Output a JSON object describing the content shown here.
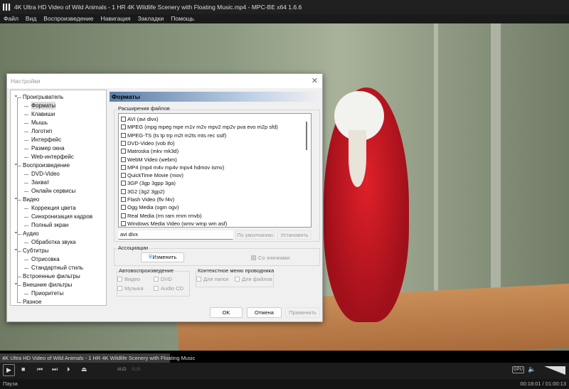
{
  "window": {
    "title": "4K Ultra HD Video of Wild Animals - 1 HR 4K Wildlife Scenery with Floating Music.mp4 - MPC-BE x64 1.6.6"
  },
  "menu": [
    "Файл",
    "Вид",
    "Воспроизведение",
    "Навигация",
    "Закладки",
    "Помощь"
  ],
  "player": {
    "filename": "4K Ultra HD Video of Wild Animals - 1 HR 4K Wildlife Scenery with Floating Music",
    "aud": "AUD",
    "sub": "SUB",
    "gpu": "GPU",
    "status": "Пауза",
    "time": "00:18:01 / 01:00:13",
    "progress": 0.299
  },
  "dialog": {
    "title": "Настройки",
    "tree": [
      {
        "label": "Проигрыватель",
        "level": 0
      },
      {
        "label": "Форматы",
        "level": 1,
        "selected": true
      },
      {
        "label": "Клавиши",
        "level": 1
      },
      {
        "label": "Мышь",
        "level": 1
      },
      {
        "label": "Логотип",
        "level": 1
      },
      {
        "label": "Интерфейс",
        "level": 1
      },
      {
        "label": "Размер окна",
        "level": 1
      },
      {
        "label": "Web-интерфейс",
        "level": 1
      },
      {
        "label": "Воспроизведение",
        "level": 0
      },
      {
        "label": "DVD-Video",
        "level": 1
      },
      {
        "label": "Захват",
        "level": 1
      },
      {
        "label": "Онлайн сервисы",
        "level": 1
      },
      {
        "label": "Видео",
        "level": 0
      },
      {
        "label": "Коррекция цвета",
        "level": 1
      },
      {
        "label": "Синхронизация кадров",
        "level": 1
      },
      {
        "label": "Полный экран",
        "level": 1
      },
      {
        "label": "Аудио",
        "level": 0
      },
      {
        "label": "Обработка звука",
        "level": 1
      },
      {
        "label": "Субтитры",
        "level": 0
      },
      {
        "label": "Отрисовка",
        "level": 1
      },
      {
        "label": "Стандартный стиль",
        "level": 1
      },
      {
        "label": "Встроенные фильтры",
        "level": 0
      },
      {
        "label": "Внешние фильтры",
        "level": 0
      },
      {
        "label": "Приоритеты",
        "level": 1
      },
      {
        "label": "Разное",
        "level": 0
      }
    ],
    "section_title": "Форматы",
    "extensions_label": "Расширения файлов",
    "formats": [
      "AVI (avi divx)",
      "MPEG (mpg mpeg mpe m1v m2v mpv2 mp2v pva evo m2p sfd)",
      "MPEG-TS (ts tp trp m2t m2ts mts rec ssif)",
      "DVD-Video (vob ifo)",
      "Matroska (mkv mk3d)",
      "WebM Video (webm)",
      "MP4 (mp4 m4v mp4v mpv4 hdmov ismv)",
      "QuickTime Movie (mov)",
      "3GP (3gp 3gpp 3ga)",
      "3G2 (3g2 3gp2)",
      "Flash Video (flv f4v)",
      "Ogg Media (ogm ogv)",
      "Real Media (rm ram rmm rmvb)",
      "Windows Media Video (wmv wmp wm asf)"
    ],
    "ext_value": "avi divx",
    "default_btn": "По умолчанию",
    "set_btn": "Установить",
    "assoc_label": "Ассоциации",
    "change_btn": "Изменить",
    "with_icons": "Со значками",
    "autoplay_label": "Автовоспроизведение",
    "autoplay": [
      "Видео",
      "DVD",
      "Музыка",
      "Audio CD"
    ],
    "context_label": "Контекстное меню проводника",
    "context": [
      "Для папок",
      "Для файлов"
    ],
    "ok": "OK",
    "cancel": "Отмена",
    "apply": "Применить"
  }
}
